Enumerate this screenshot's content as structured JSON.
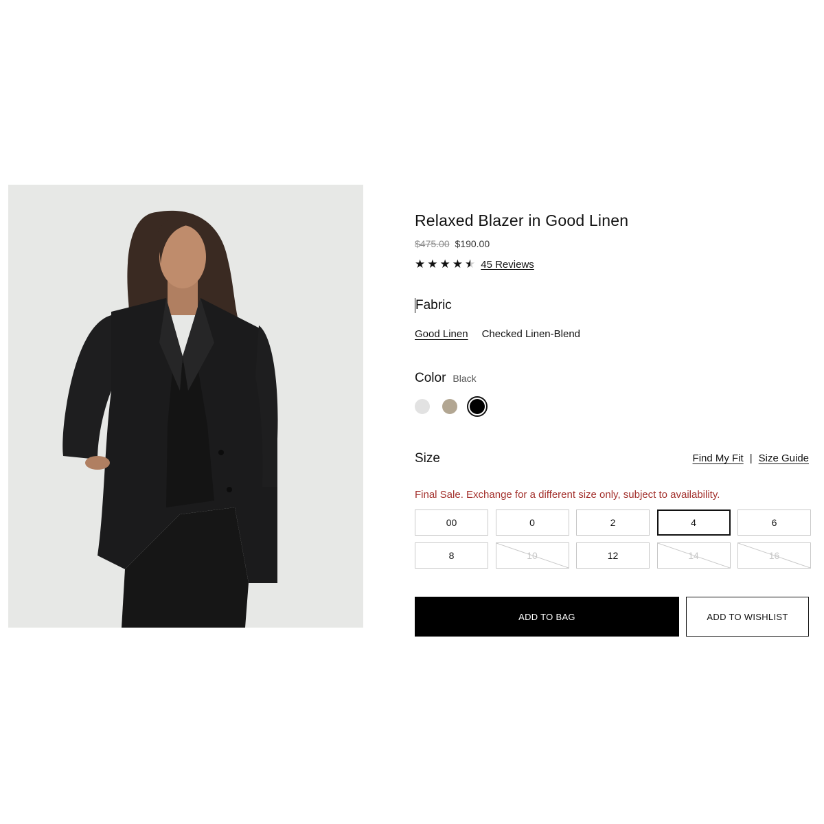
{
  "product": {
    "title": "Relaxed Blazer in Good Linen",
    "original_price": "$475.00",
    "sale_price": "$190.00",
    "rating": 4.5,
    "rating_max": 5,
    "reviews_label": "45 Reviews"
  },
  "fabric": {
    "label": "Fabric",
    "options": [
      {
        "label": "Good Linen",
        "selected": true
      },
      {
        "label": "Checked Linen-Blend",
        "selected": false
      }
    ]
  },
  "color": {
    "label": "Color",
    "selected_name": "Black",
    "swatches": [
      {
        "name": "light-grey",
        "hex": "#e2e2e2",
        "selected": false
      },
      {
        "name": "taupe",
        "hex": "#b2a692",
        "selected": false
      },
      {
        "name": "black",
        "hex": "#000000",
        "selected": true
      }
    ]
  },
  "size": {
    "label": "Size",
    "find_my_fit": "Find My Fit",
    "separator": "|",
    "size_guide": "Size Guide",
    "notice": "Final Sale. Exchange for a different size only, subject to availability.",
    "notice_color": "#a3302c",
    "options": [
      {
        "label": "00",
        "available": true,
        "selected": false
      },
      {
        "label": "0",
        "available": true,
        "selected": false
      },
      {
        "label": "2",
        "available": true,
        "selected": false
      },
      {
        "label": "4",
        "available": true,
        "selected": true
      },
      {
        "label": "6",
        "available": true,
        "selected": false
      },
      {
        "label": "8",
        "available": true,
        "selected": false
      },
      {
        "label": "10",
        "available": false,
        "selected": false
      },
      {
        "label": "12",
        "available": true,
        "selected": false
      },
      {
        "label": "14",
        "available": false,
        "selected": false
      },
      {
        "label": "16",
        "available": false,
        "selected": false
      }
    ]
  },
  "actions": {
    "add_to_bag": "ADD TO BAG",
    "add_to_wishlist": "ADD TO WISHLIST"
  }
}
